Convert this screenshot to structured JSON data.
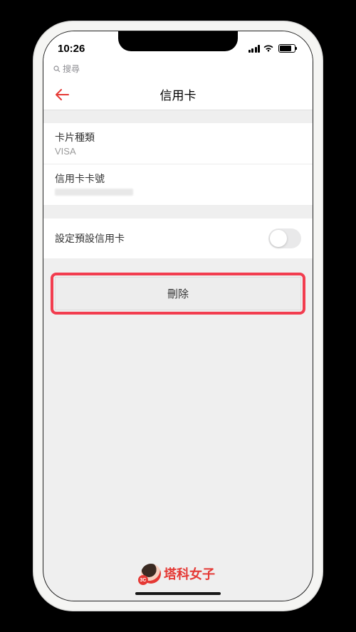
{
  "status": {
    "time": "10:26",
    "search_label": "搜尋"
  },
  "nav": {
    "title": "信用卡"
  },
  "card_type": {
    "label": "卡片種類",
    "value": "VISA"
  },
  "card_number": {
    "label": "信用卡卡號"
  },
  "toggle": {
    "label": "設定預設信用卡",
    "on": false
  },
  "delete": {
    "label": "刪除"
  },
  "watermark": {
    "badge": "3C",
    "text": "塔科女子"
  }
}
